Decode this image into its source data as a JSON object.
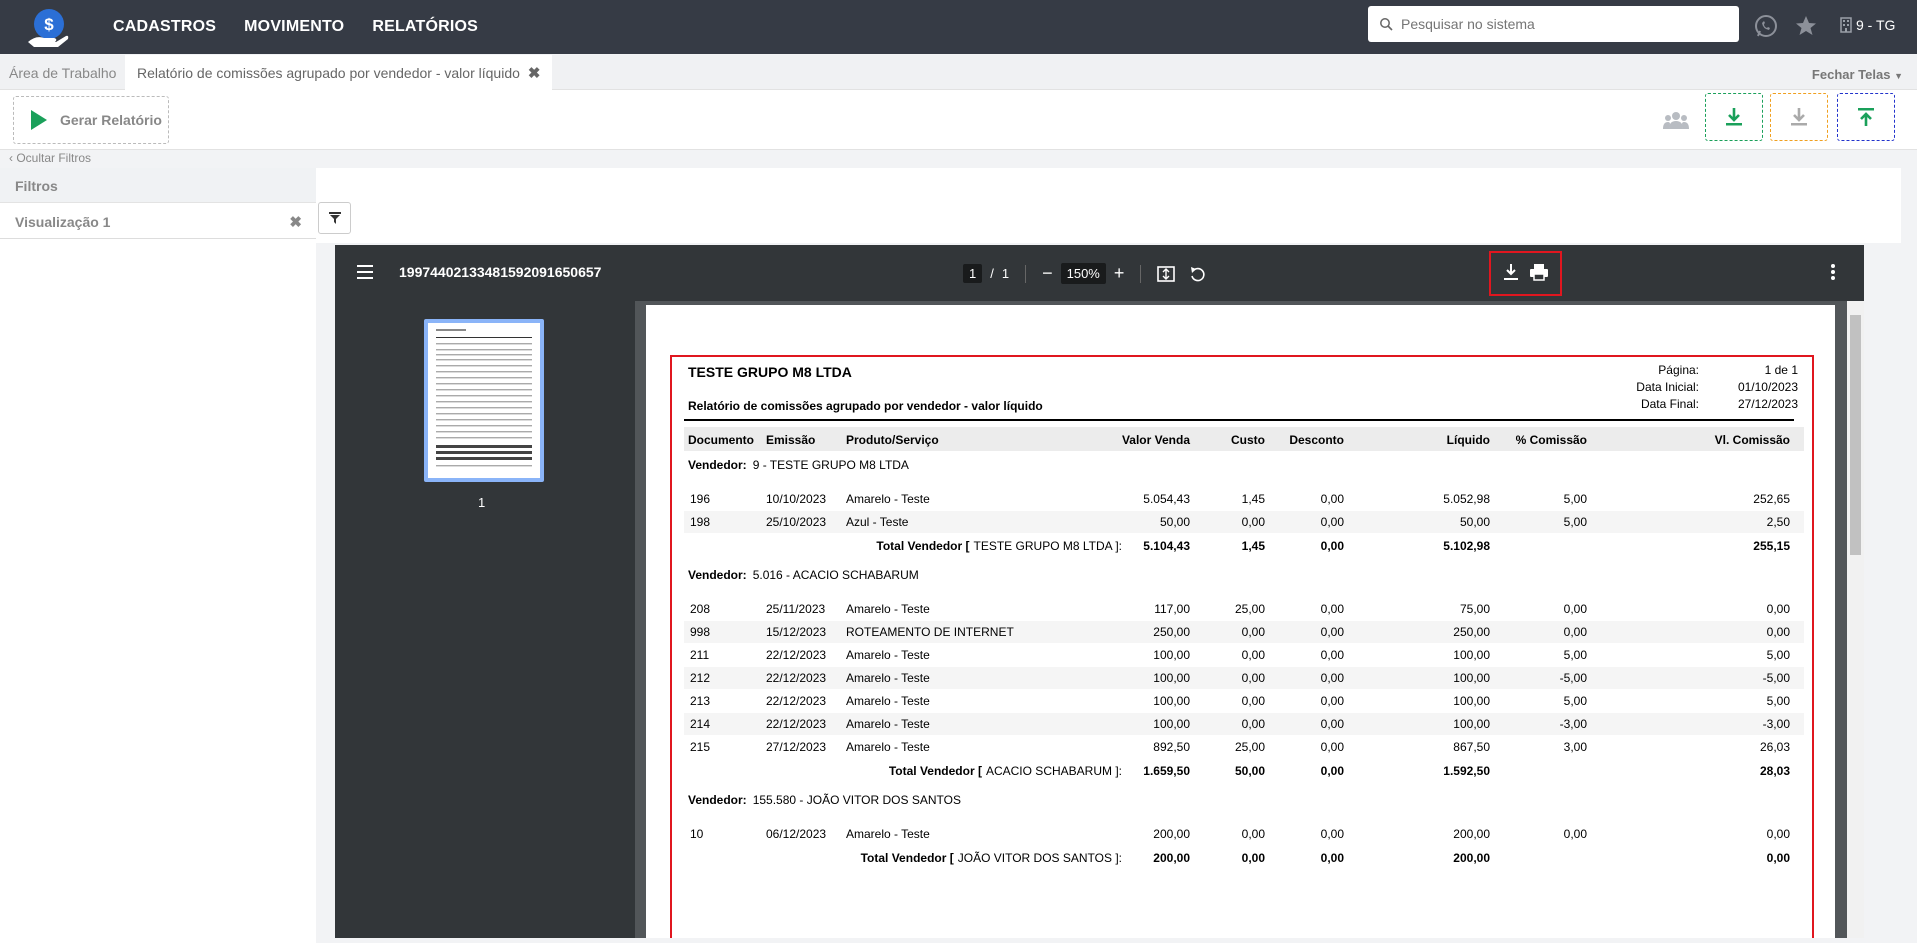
{
  "topnav": {
    "items": [
      "CADASTROS",
      "MOVIMENTO",
      "RELATÓRIOS"
    ]
  },
  "search": {
    "placeholder": "Pesquisar no sistema"
  },
  "company": {
    "label": "9 - TG"
  },
  "tabs": {
    "work": "Área de Trabalho",
    "report": "Relatório de comissões agrupado por vendedor - valor líquido",
    "close_all": "Fechar Telas"
  },
  "toolbar": {
    "generate": "Gerar Relatório"
  },
  "filters": {
    "hide": "Ocultar Filtros",
    "title": "Filtros",
    "view": "Visualização 1"
  },
  "viewer": {
    "filename": "19974402133481592091650657",
    "page": "1",
    "pages": "1",
    "zoom": "150%",
    "thumb_label": "1"
  },
  "report": {
    "company": "TESTE GRUPO M8 LTDA",
    "title": "Relatório de comissões agrupado por vendedor - valor líquido",
    "meta_labels": [
      "Página:",
      "Data Inicial:",
      "Data Final:"
    ],
    "meta_values": [
      "1 de 1",
      "01/10/2023",
      "27/12/2023"
    ],
    "columns": [
      "Documento",
      "Emissão",
      "Produto/Serviço",
      "Valor Venda",
      "Custo",
      "Desconto",
      "Líquido",
      "% Comissão",
      "Vl. Comissão"
    ],
    "vendor_label": "Vendedor:",
    "total_label": "Total Vendedor [",
    "groups": [
      {
        "vendor": "9 - TESTE GRUPO M8 LTDA",
        "rows": [
          [
            "196",
            "10/10/2023",
            "Amarelo - Teste",
            "5.054,43",
            "1,45",
            "0,00",
            "5.052,98",
            "5,00",
            "252,65"
          ],
          [
            "198",
            "25/10/2023",
            "Azul - Teste",
            "50,00",
            "0,00",
            "0,00",
            "50,00",
            "5,00",
            "2,50"
          ]
        ],
        "total_name": "TESTE GRUPO M8 LTDA ]:",
        "totals": [
          "5.104,43",
          "1,45",
          "0,00",
          "5.102,98",
          "255,15"
        ]
      },
      {
        "vendor": "5.016 - ACACIO SCHABARUM",
        "rows": [
          [
            "208",
            "25/11/2023",
            "Amarelo - Teste",
            "117,00",
            "25,00",
            "0,00",
            "75,00",
            "0,00",
            "0,00"
          ],
          [
            "998",
            "15/12/2023",
            "ROTEAMENTO DE INTERNET",
            "250,00",
            "0,00",
            "0,00",
            "250,00",
            "0,00",
            "0,00"
          ],
          [
            "211",
            "22/12/2023",
            "Amarelo - Teste",
            "100,00",
            "0,00",
            "0,00",
            "100,00",
            "5,00",
            "5,00"
          ],
          [
            "212",
            "22/12/2023",
            "Amarelo - Teste",
            "100,00",
            "0,00",
            "0,00",
            "100,00",
            "-5,00",
            "-5,00"
          ],
          [
            "213",
            "22/12/2023",
            "Amarelo - Teste",
            "100,00",
            "0,00",
            "0,00",
            "100,00",
            "5,00",
            "5,00"
          ],
          [
            "214",
            "22/12/2023",
            "Amarelo - Teste",
            "100,00",
            "0,00",
            "0,00",
            "100,00",
            "-3,00",
            "-3,00"
          ],
          [
            "215",
            "27/12/2023",
            "Amarelo - Teste",
            "892,50",
            "25,00",
            "0,00",
            "867,50",
            "3,00",
            "26,03"
          ]
        ],
        "total_name": "ACACIO SCHABARUM ]:",
        "totals": [
          "1.659,50",
          "50,00",
          "0,00",
          "1.592,50",
          "28,03"
        ]
      },
      {
        "vendor": "155.580 - JOÃO VITOR DOS SANTOS",
        "rows": [
          [
            "10",
            "06/12/2023",
            "Amarelo - Teste",
            "200,00",
            "0,00",
            "0,00",
            "200,00",
            "0,00",
            "0,00"
          ]
        ],
        "total_name": "JOÃO VITOR DOS SANTOS ]:",
        "totals": [
          "200,00",
          "0,00",
          "0,00",
          "200,00",
          "0,00"
        ]
      }
    ]
  },
  "colors": {
    "topbar": "#363b45",
    "green": "#1aa05a",
    "orange": "#f0a020",
    "blue": "#2233cc",
    "highlight": "#e0161f"
  }
}
